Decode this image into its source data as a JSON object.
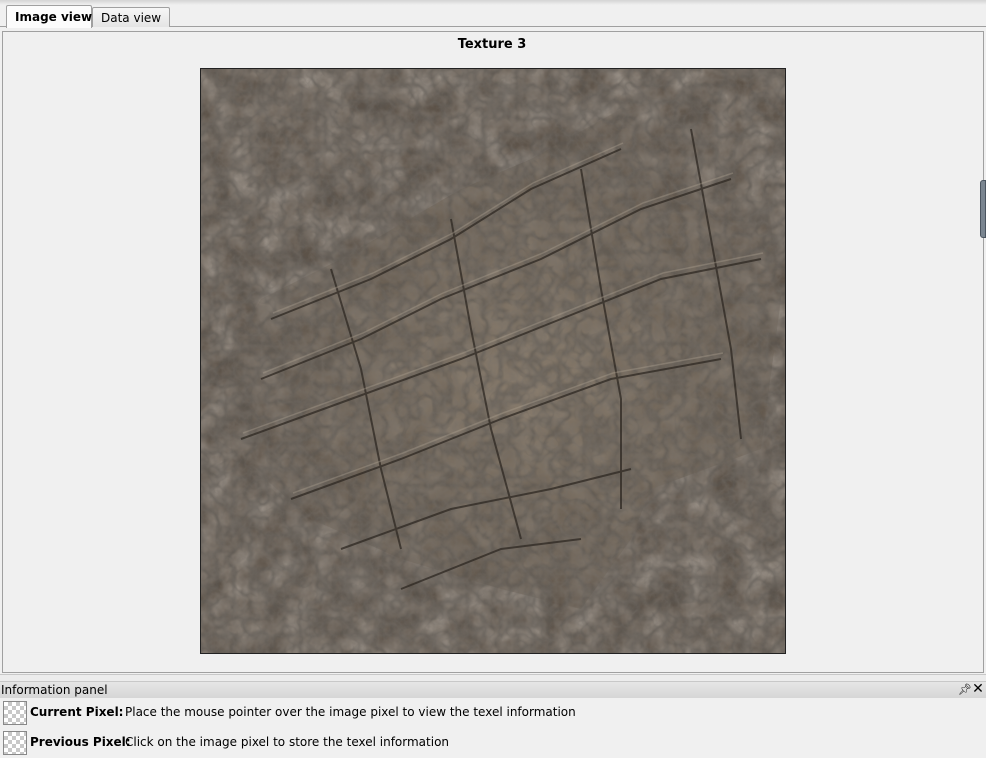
{
  "tabs": [
    {
      "label": "Image view",
      "active": true
    },
    {
      "label": "Data view",
      "active": false
    }
  ],
  "texture": {
    "title": "Texture 3"
  },
  "info_panel": {
    "title": "Information panel",
    "pin_icon": "pin-icon",
    "close_icon": "close-icon",
    "current": {
      "label": "Current Pixel:",
      "text": "Place the mouse pointer over the image pixel to view the texel information"
    },
    "previous": {
      "label": "Previous Pixel:",
      "text": "Click on the image pixel to store the texel information"
    }
  }
}
